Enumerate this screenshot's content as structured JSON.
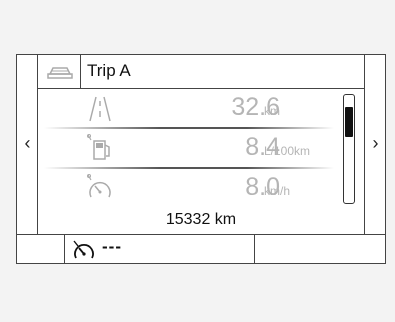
{
  "header": {
    "title": "Trip A",
    "icon": "car-icon"
  },
  "navigation": {
    "left_arrow": "‹",
    "right_arrow": "›"
  },
  "rows": [
    {
      "icon": "road-distance-icon",
      "value": "32.6",
      "unit": "km"
    },
    {
      "icon": "fuel-pump-icon",
      "value": "8.4",
      "unit": "L/100km"
    },
    {
      "icon": "speedometer-icon",
      "value": "8.0",
      "unit": "km/h"
    }
  ],
  "odometer": "15332 km",
  "scroll": {
    "position_fraction": 0.15
  },
  "footer": {
    "speed_limiter_icon": "speed-limiter-icon",
    "speed_limiter_value": "---"
  },
  "colors": {
    "value_text": "#b5b5b5",
    "frame": "#444444"
  }
}
